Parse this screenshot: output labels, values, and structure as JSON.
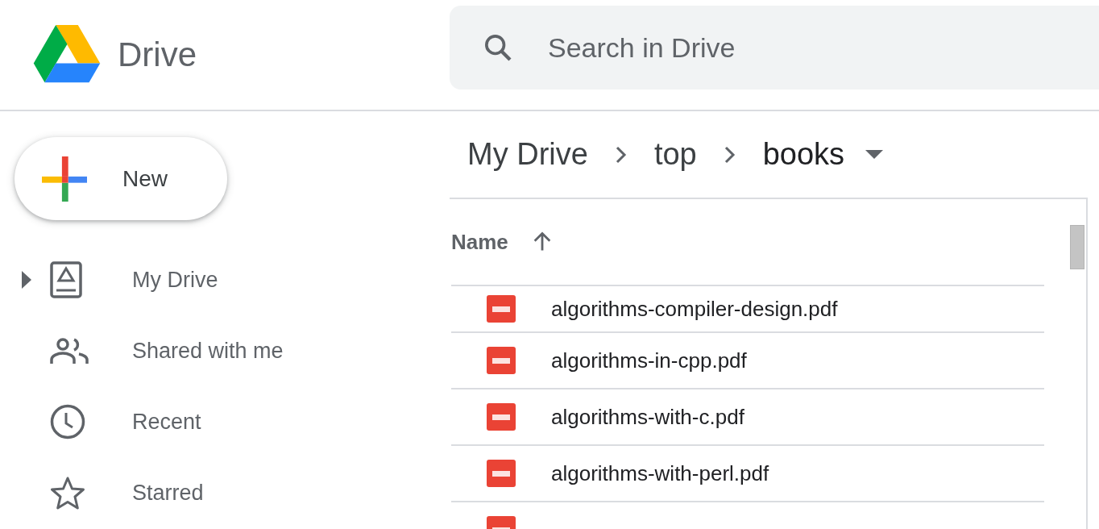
{
  "header": {
    "app_name": "Drive",
    "search": {
      "placeholder": "Search in Drive"
    }
  },
  "sidebar": {
    "new_button": "New",
    "items": [
      {
        "label": "My Drive",
        "kind": "drive",
        "expandable": true,
        "selected": false
      },
      {
        "label": "Shared with me",
        "kind": "people",
        "expandable": false,
        "selected": false
      },
      {
        "label": "Recent",
        "kind": "clock",
        "expandable": false,
        "selected": false
      },
      {
        "label": "Starred",
        "kind": "star",
        "expandable": false,
        "selected": false
      }
    ]
  },
  "breadcrumb": [
    {
      "label": "My Drive",
      "current": false
    },
    {
      "label": "top",
      "current": false
    },
    {
      "label": "books",
      "current": true
    }
  ],
  "table": {
    "columns": [
      {
        "label": "Name",
        "sorted": true
      }
    ],
    "rows": [
      {
        "name": "algorithms-compiler-design.pdf",
        "kind": "pdf"
      },
      {
        "name": "algorithms-in-cpp.pdf",
        "kind": "pdf"
      },
      {
        "name": "algorithms-with-c.pdf",
        "kind": "pdf"
      },
      {
        "name": "algorithms-with-perl.pdf",
        "kind": "pdf"
      },
      {
        "kind": "pdf"
      }
    ]
  }
}
